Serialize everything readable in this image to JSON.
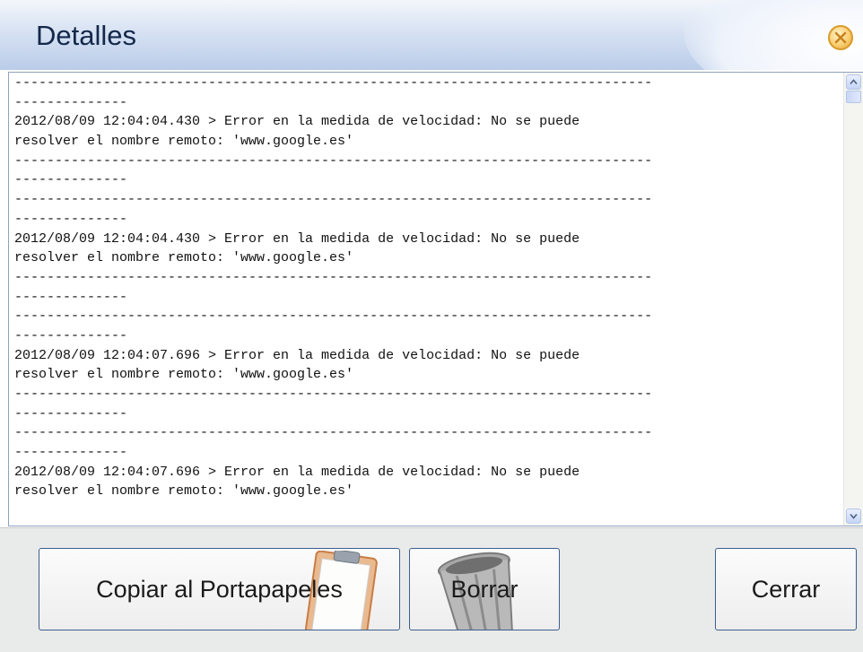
{
  "window": {
    "title": "Detalles"
  },
  "log": {
    "lines": [
      "-------------------------------------------------------------------------------",
      "--------------",
      "2012/08/09 12:04:04.430 > Error en la medida de velocidad: No se puede",
      "resolver el nombre remoto: 'www.google.es'",
      "-------------------------------------------------------------------------------",
      "--------------",
      "-------------------------------------------------------------------------------",
      "--------------",
      "2012/08/09 12:04:04.430 > Error en la medida de velocidad: No se puede",
      "resolver el nombre remoto: 'www.google.es'",
      "-------------------------------------------------------------------------------",
      "--------------",
      "-------------------------------------------------------------------------------",
      "--------------",
      "2012/08/09 12:04:07.696 > Error en la medida de velocidad: No se puede",
      "resolver el nombre remoto: 'www.google.es'",
      "-------------------------------------------------------------------------------",
      "--------------",
      "-------------------------------------------------------------------------------",
      "--------------",
      "2012/08/09 12:04:07.696 > Error en la medida de velocidad: No se puede",
      "resolver el nombre remoto: 'www.google.es'"
    ]
  },
  "buttons": {
    "copy_label": "Copiar al Portapapeles",
    "clear_label": "Borrar",
    "close_label": "Cerrar"
  },
  "icons": {
    "close": "close-icon",
    "clipboard": "clipboard-icon",
    "trash": "trash-icon"
  },
  "colors": {
    "titlebar_top": "#f3f6fb",
    "titlebar_bottom": "#b9cce9",
    "close_accent": "#f2b24d",
    "button_border": "#3c5f8f",
    "footer_bg": "#e9eaea"
  }
}
